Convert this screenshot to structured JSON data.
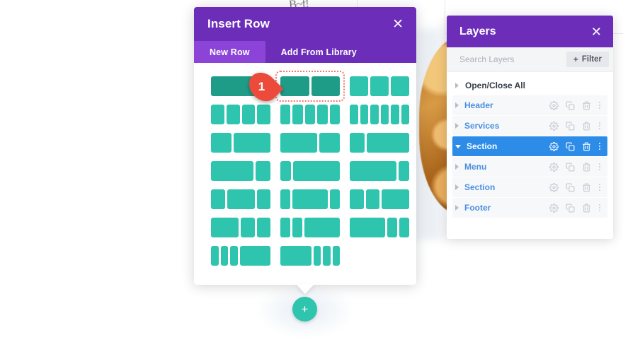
{
  "background": {
    "scribble_text": "B~f!"
  },
  "insert_row_modal": {
    "title": "Insert Row",
    "close_icon": "close-icon",
    "tabs": [
      {
        "label": "New Row",
        "active": true
      },
      {
        "label": "Add From Library",
        "active": false
      }
    ],
    "marker": {
      "number": "1",
      "color": "#ec4b3b"
    },
    "colors": {
      "header_purple": "#6c2eb9",
      "tab_active_purple": "#8b44d7",
      "column_teal": "#2ec4ad",
      "column_teal_hover": "#1f9c88",
      "target_outline": "#f0796b"
    },
    "layouts": [
      {
        "name": "1-column",
        "widths": [
          100
        ],
        "state": "hovered"
      },
      {
        "name": "2-column",
        "widths": [
          50,
          50
        ],
        "state": "targeted"
      },
      {
        "name": "3-column",
        "widths": [
          33,
          33,
          33
        ],
        "state": "normal"
      },
      {
        "name": "4-column",
        "widths": [
          25,
          25,
          25,
          25
        ],
        "state": "normal"
      },
      {
        "name": "5-column",
        "widths": [
          20,
          20,
          20,
          20,
          20
        ],
        "state": "normal"
      },
      {
        "name": "6-column",
        "widths": [
          16,
          16,
          16,
          16,
          16,
          16
        ],
        "state": "normal"
      },
      {
        "name": "1/3-2/3",
        "widths": [
          36,
          64
        ],
        "state": "normal"
      },
      {
        "name": "2/3-1/3",
        "widths": [
          64,
          36
        ],
        "state": "normal"
      },
      {
        "name": "1/4-3/4",
        "widths": [
          26,
          74
        ],
        "state": "normal"
      },
      {
        "name": "3/4-1/4",
        "widths": [
          74,
          26
        ],
        "state": "normal"
      },
      {
        "name": "1/5-4/5",
        "widths": [
          18,
          82
        ],
        "state": "normal"
      },
      {
        "name": "4/5-1/5",
        "widths": [
          82,
          18
        ],
        "state": "normal"
      },
      {
        "name": "1/4-1/2-1/4",
        "widths": [
          25,
          50,
          25
        ],
        "state": "normal"
      },
      {
        "name": "1/5-3/5-1/5",
        "widths": [
          18,
          64,
          18
        ],
        "state": "normal"
      },
      {
        "name": "1/4-1/4-1/2",
        "widths": [
          25,
          25,
          50
        ],
        "state": "normal"
      },
      {
        "name": "1/2-1/4-1/4",
        "widths": [
          50,
          25,
          25
        ],
        "state": "normal"
      },
      {
        "name": "1/5-1/5-3/5",
        "widths": [
          18,
          18,
          64
        ],
        "state": "normal"
      },
      {
        "name": "3/5-1/5-1/5",
        "widths": [
          64,
          18,
          18
        ],
        "state": "normal"
      },
      {
        "name": "1/6-1/6-1/6-1/2",
        "widths": [
          14,
          14,
          14,
          58
        ],
        "state": "normal"
      },
      {
        "name": "1/2-1/6-1/6-1/6",
        "widths": [
          58,
          14,
          14,
          14
        ],
        "state": "normal"
      },
      {
        "name": "empty-slot",
        "widths": [],
        "state": "empty"
      }
    ]
  },
  "add_button": {
    "label": "+",
    "icon": "plus-icon"
  },
  "layers_panel": {
    "title": "Layers",
    "close_icon": "close-icon",
    "search": {
      "placeholder": "Search Layers",
      "value": ""
    },
    "filter": {
      "label": "Filter",
      "icon": "plus-icon"
    },
    "open_close_all": "Open/Close All",
    "row_icons": [
      "gear-icon",
      "duplicate-icon",
      "trash-icon",
      "kebab-menu-icon"
    ],
    "selected_color": "#2d8ce8",
    "link_color": "#4a8fe0",
    "layers": [
      {
        "name": "Header",
        "selected": false,
        "expanded": false
      },
      {
        "name": "Services",
        "selected": false,
        "expanded": false
      },
      {
        "name": "Section",
        "selected": true,
        "expanded": true
      },
      {
        "name": "Menu",
        "selected": false,
        "expanded": false
      },
      {
        "name": "Section",
        "selected": false,
        "expanded": false
      },
      {
        "name": "Footer",
        "selected": false,
        "expanded": false
      }
    ]
  }
}
